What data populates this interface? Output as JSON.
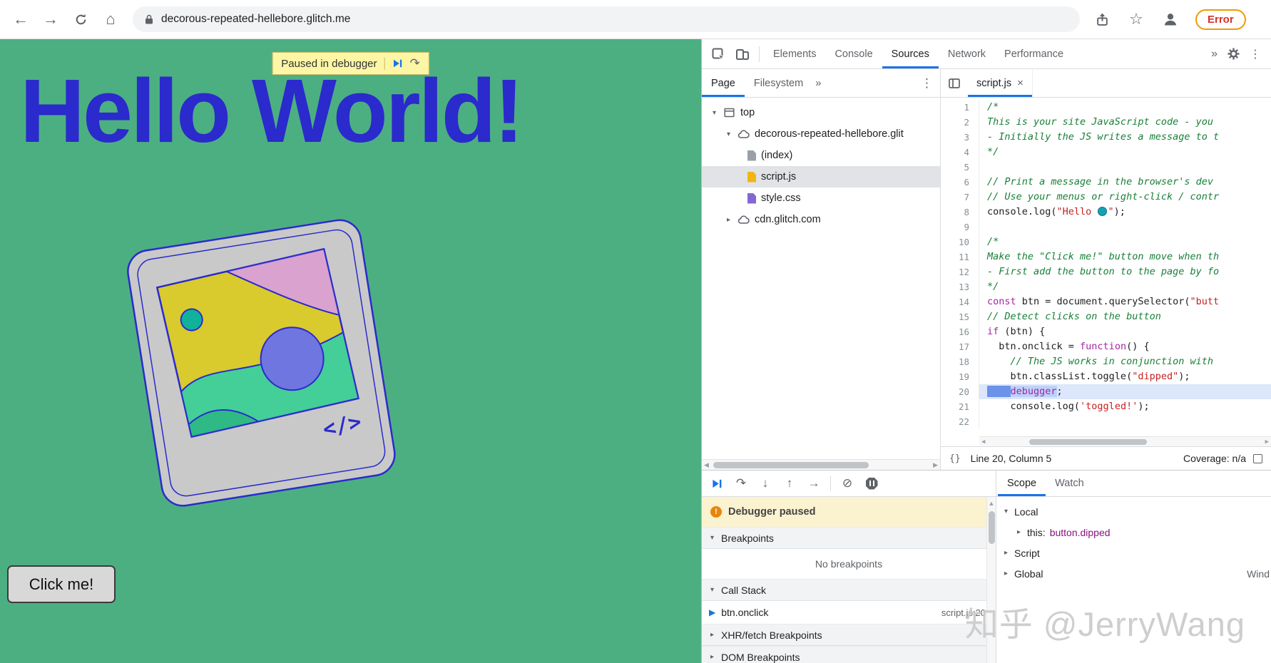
{
  "colors": {
    "accent": "#1a73e8",
    "page_bg": "#4caf82",
    "heading": "#2b2acc",
    "error": "#d93025"
  },
  "browser": {
    "url": "decorous-repeated-hellebore.glitch.me",
    "error_button": "Error"
  },
  "page": {
    "paused_banner": "Paused in debugger",
    "heading": "Hello World!",
    "click_button": "Click me!"
  },
  "devtools": {
    "main_tabs": [
      {
        "label": "Elements"
      },
      {
        "label": "Console"
      },
      {
        "label": "Sources",
        "active": true
      },
      {
        "label": "Network"
      },
      {
        "label": "Performance"
      }
    ],
    "sidebar": {
      "tabs": [
        {
          "label": "Page",
          "active": true
        },
        {
          "label": "Filesystem"
        }
      ],
      "tree": {
        "top": "top",
        "origin": "decorous-repeated-hellebore.glit",
        "index": "(index)",
        "script": "script.js",
        "style": "style.css",
        "cdn": "cdn.glitch.com"
      }
    },
    "editor": {
      "tab": "script.js",
      "status_line": "Line 20, Column 5",
      "status_coverage": "Coverage: n/a",
      "lines": [
        {
          "t": [
            [
              "/*",
              "com"
            ]
          ]
        },
        {
          "t": [
            [
              "This is your site JavaScript code - you",
              "com"
            ]
          ]
        },
        {
          "t": [
            [
              "- Initially the JS writes a message to t",
              "com"
            ]
          ]
        },
        {
          "t": [
            [
              "*/",
              "com"
            ]
          ]
        },
        {
          "t": []
        },
        {
          "t": [
            [
              "// Print a message in the browser's dev",
              "com"
            ]
          ]
        },
        {
          "t": [
            [
              "// Use your menus or right-click / contr",
              "com"
            ]
          ]
        },
        {
          "t": [
            [
              "console.log(",
              "pln"
            ],
            [
              "\"Hello ",
              "str"
            ],
            [
              "",
              "glb"
            ],
            [
              "\"",
              "str"
            ],
            [
              ");",
              "pln"
            ]
          ]
        },
        {
          "t": []
        },
        {
          "t": [
            [
              "/*",
              "com"
            ]
          ]
        },
        {
          "t": [
            [
              "Make the \"Click me!\" button move when th",
              "com"
            ]
          ]
        },
        {
          "t": [
            [
              "- First add the button to the page by fo",
              "com"
            ]
          ]
        },
        {
          "t": [
            [
              "*/",
              "com"
            ]
          ]
        },
        {
          "t": [
            [
              "const",
              "kw"
            ],
            [
              " btn = document.querySelector(",
              "pln"
            ],
            [
              "\"butt",
              "str"
            ]
          ]
        },
        {
          "t": [
            [
              "// Detect clicks on the button",
              "com"
            ]
          ]
        },
        {
          "t": [
            [
              "if",
              "kw"
            ],
            [
              " (btn) {",
              "pln"
            ]
          ]
        },
        {
          "t": [
            [
              "  btn.onclick = ",
              "pln"
            ],
            [
              "function",
              "kw"
            ],
            [
              "() {",
              "pln"
            ]
          ]
        },
        {
          "t": [
            [
              "    ",
              "pln"
            ],
            [
              "// The JS works in conjunction with",
              "com"
            ]
          ]
        },
        {
          "t": [
            [
              "    btn.classList.toggle(",
              "pln"
            ],
            [
              "\"dipped\"",
              "str"
            ],
            [
              ");",
              "pln"
            ]
          ]
        },
        {
          "current": true,
          "t": [
            [
              "    ",
              "ind"
            ],
            [
              "debugger",
              "kwsel"
            ],
            [
              ";",
              "pln"
            ]
          ]
        },
        {
          "t": [
            [
              "    console.log(",
              "pln"
            ],
            [
              "'toggled!'",
              "str"
            ],
            [
              ");",
              "pln"
            ]
          ]
        },
        {
          "t": []
        }
      ]
    },
    "debugger_pane": {
      "paused": "Debugger paused",
      "breakpoints_header": "Breakpoints",
      "no_breakpoints": "No breakpoints",
      "call_stack_header": "Call Stack",
      "frame_name": "btn.onclick",
      "frame_loc": "script.js:20",
      "xhr_header": "XHR/fetch Breakpoints",
      "dom_header": "DOM Breakpoints"
    },
    "scope_pane": {
      "tabs": [
        {
          "label": "Scope",
          "active": true
        },
        {
          "label": "Watch"
        }
      ],
      "local": "Local",
      "this_name": "this: ",
      "this_value": "button.dipped",
      "script": "Script",
      "global": "Global",
      "global_value": "Wind"
    }
  },
  "icons": {
    "back": "←",
    "forward": "→",
    "home": "⌂",
    "star": "☆",
    "kebab": "⋮",
    "more": "»",
    "tri_down": "▾",
    "tri_right": "▸",
    "close": "×",
    "pretty_print": "{}",
    "step_over": "↷",
    "step_into": "↓",
    "step_out": "↑",
    "step": "→",
    "slash": "⊘",
    "marker": "▶",
    "warn": "!",
    "left": "◀",
    "right": "▶",
    "up": "▲"
  },
  "watermark": "知乎 @JerryWang"
}
